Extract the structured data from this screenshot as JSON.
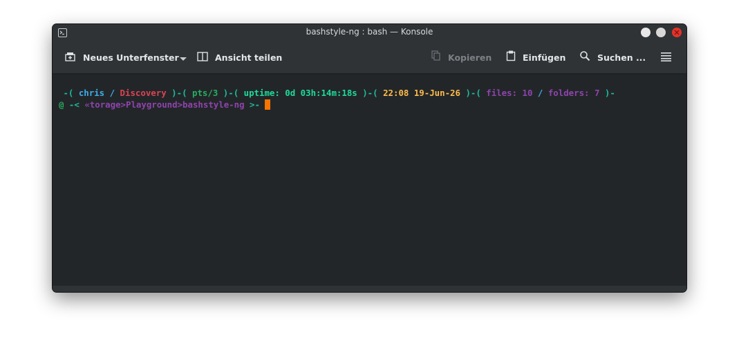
{
  "window": {
    "title": "bashstyle-ng : bash — Konsole"
  },
  "toolbar": {
    "new_tab_label": "Neues Unterfenster",
    "split_view_label": "Ansicht teilen",
    "copy_label": "Kopieren",
    "paste_label": "Einfügen",
    "search_label": "Suchen ...",
    "icons": {
      "new_tab": "new-tab-icon",
      "dropdown": "chevron-down-icon",
      "split": "split-view-icon",
      "copy": "copy-icon",
      "paste": "paste-icon",
      "search": "search-icon",
      "menu": "hamburger-menu-icon"
    }
  },
  "terminal": {
    "line1": {
      "p1": " -( ",
      "user": "chris",
      "sep1": " / ",
      "host": "Discovery",
      "p2": " )-( ",
      "tty": "pts/3",
      "p3": " )-( ",
      "uptime": "uptime: 0d 03h:14m:18s",
      "p4": " )-( ",
      "time": "22:08",
      "sp": " ",
      "date": "19-Jun-26",
      "p5": " )-( ",
      "files": "files: 10",
      "sep2": " / ",
      "folders": "folders: 7",
      "p6": " )-"
    },
    "line2": {
      "at": "@",
      "open": " -< ",
      "path": "«torage>Playground>bashstyle-ng",
      "close": " >- "
    }
  },
  "colors": {
    "background": "#232629",
    "titlebar": "#2f3336",
    "cursor": "#f67400",
    "close_button": "#e5332a",
    "blue": "#3daee9",
    "red": "#da4453",
    "cyan": "#1cdc9a",
    "orange": "#fdbc4b",
    "purple": "#8e44ad"
  }
}
